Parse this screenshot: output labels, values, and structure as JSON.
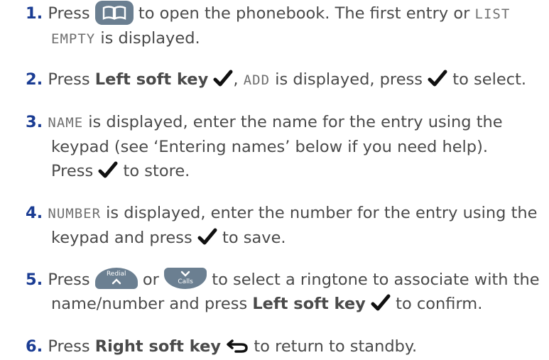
{
  "steps": [
    {
      "number": "1",
      "line1_a": "Press",
      "line1_b": "to open the phonebook.  The first entry or",
      "lcd_list": "LIST",
      "lcd_empty": "EMPTY",
      "line2_b": "is displayed."
    },
    {
      "number": "2",
      "press": "Press",
      "key": "Left soft key",
      "comma": ",",
      "lcd_add": "ADD",
      "rest_a": "is displayed, press",
      "rest_b": "to select."
    },
    {
      "number": "3",
      "lcd_name": "NAME",
      "line1": "is displayed, enter the name for the entry using the",
      "line2": "keypad (see ‘Entering names’ below if you need help).",
      "line3_a": "Press",
      "line3_b": "to store."
    },
    {
      "number": "4",
      "lcd_number": "NUMBER",
      "line1": "is displayed, enter the number for the entry using the",
      "line2_a": "keypad and press",
      "line2_b": "to save."
    },
    {
      "number": "5",
      "press": "Press",
      "or": "or",
      "line1_b": "to select a ringtone to associate with the",
      "line2_a": "name/number and press",
      "key": "Left soft key",
      "line2_b": "to confirm.",
      "redial_label": "Redial",
      "calls_label": "Calls"
    },
    {
      "number": "6",
      "press": "Press",
      "key": "Right soft key",
      "rest": "to return to standby."
    }
  ],
  "colors": {
    "step_number": "#1a3c93",
    "text": "#4a4a4a",
    "button": "#6b7f91"
  },
  "icons": [
    "phonebook-icon",
    "check-icon",
    "redial-up-icon",
    "calls-down-icon",
    "back-arrow-icon"
  ]
}
